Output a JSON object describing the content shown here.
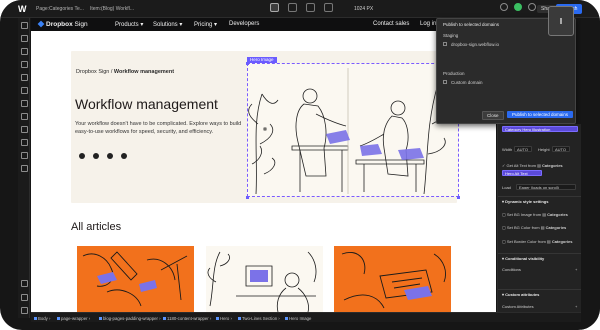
{
  "topbar": {
    "app_logo": "W",
    "page_label": "Page:",
    "page_name": "Categories Te...",
    "item_label": "Item:",
    "item_name": "(Blog) Workfl...",
    "canvas_width": "1024 PX",
    "share_label": "Share",
    "publish_label": "Publish"
  },
  "site_nav": {
    "brand": "Dropbox",
    "brand_suffix": "Sign",
    "items": [
      "Products",
      "Solutions",
      "Pricing",
      "Developers"
    ],
    "contact": "Contact sales",
    "login": "Log in"
  },
  "hero": {
    "breadcrumb_parent": "Dropbox Sign",
    "breadcrumb_separator": "/",
    "breadcrumb_current": "Workflow management",
    "title": "Workflow management",
    "subtitle": "Your workflow doesn't have to be complicated. Explore ways to build easy-to-use workflows for speed, security, and efficiency.",
    "image_tag": "Hero Image",
    "social_icons": [
      "facebook-icon",
      "twitter-icon",
      "linkedin-icon",
      "rss-icon"
    ]
  },
  "articles": {
    "heading": "All articles"
  },
  "publish_dialog": {
    "title": "Publish to selected domains",
    "option_1": "Staging",
    "option_1_sub": "dropbox-sign.webflow.io",
    "option_2": "Production",
    "option_2_sub": "Custom domain",
    "close_label": "Close",
    "publish_label": "Publish to selected domains"
  },
  "right_panel": {
    "field_category": "Category Hero Illustration",
    "width_label": "Width",
    "width_value": "AUTO",
    "height_label": "Height",
    "height_value": "AUTO",
    "alt_row": "Get Alt Text from",
    "alt_source": "Categories",
    "alt_field": "Hero Alt Text",
    "load_label": "Load",
    "load_value": "Eager (loads on scroll)",
    "dynamic_header": "Dynamic style settings",
    "bg_image_row": "Set BG Image from",
    "bg_image_source": "Categories",
    "bg_color_row": "Set BG Color from",
    "bg_color_source": "Categories",
    "border_row": "Set Border Color from",
    "border_source": "Categories",
    "conditional_header": "Conditional visibility",
    "conditions_label": "Conditions",
    "custom_header": "Custom attributes",
    "custom_label": "Custom Attributes"
  },
  "statusbar": {
    "crumbs": [
      "Body",
      "page-wrapper",
      "blog-pages-padding-wrapper",
      "1180-content-wrapper",
      "Hero",
      "Two-Lines Section",
      "Hero Image"
    ]
  }
}
